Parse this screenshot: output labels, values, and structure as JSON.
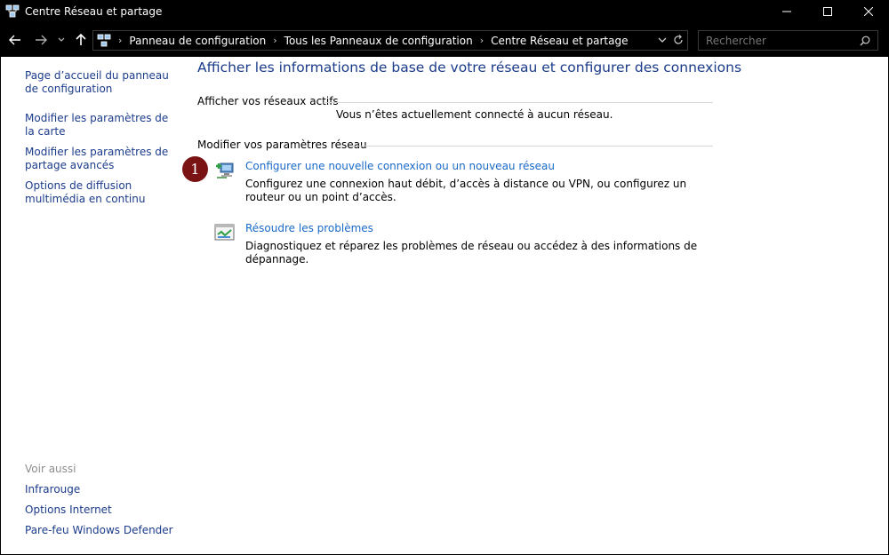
{
  "window": {
    "title": "Centre Réseau et partage"
  },
  "addressbar": {
    "breadcrumbs": [
      "Panneau de configuration",
      "Tous les Panneaux de configuration",
      "Centre Réseau et partage"
    ]
  },
  "search": {
    "placeholder": "Rechercher"
  },
  "sidebar": {
    "links": [
      "Page d’accueil du panneau de configuration",
      "Modifier les paramètres de la carte",
      "Modifier les paramètres de partage avancés",
      "Options de diffusion multimédia en continu"
    ],
    "see_also_heading": "Voir aussi",
    "see_also": [
      "Infrarouge",
      "Options Internet",
      "Pare-feu Windows Defender"
    ]
  },
  "main": {
    "title": "Afficher les informations de base de votre réseau et configurer des connexions",
    "active_networks_heading": "Afficher vos réseaux actifs",
    "active_networks_status": "Vous n’êtes actuellement connecté à aucun réseau.",
    "change_settings_heading": "Modifier vos paramètres réseau",
    "tasks": [
      {
        "label": "Configurer une nouvelle connexion ou un nouveau réseau",
        "description": "Configurez une connexion haut débit, d’accès à distance ou VPN, ou configurez un routeur ou un point d’accès.",
        "icon": "new-connection-icon"
      },
      {
        "label": "Résoudre les problèmes",
        "description": "Diagnostiquez et réparez les problèmes de réseau ou accédez à des informations de dépannage.",
        "icon": "troubleshoot-icon"
      }
    ]
  },
  "annotation": {
    "marker_number": "1",
    "marker_color": "#7a1414"
  },
  "colors": {
    "link": "#1b3b8b",
    "task_link": "#1b6ac9",
    "titlebar_bg": "#000000"
  }
}
